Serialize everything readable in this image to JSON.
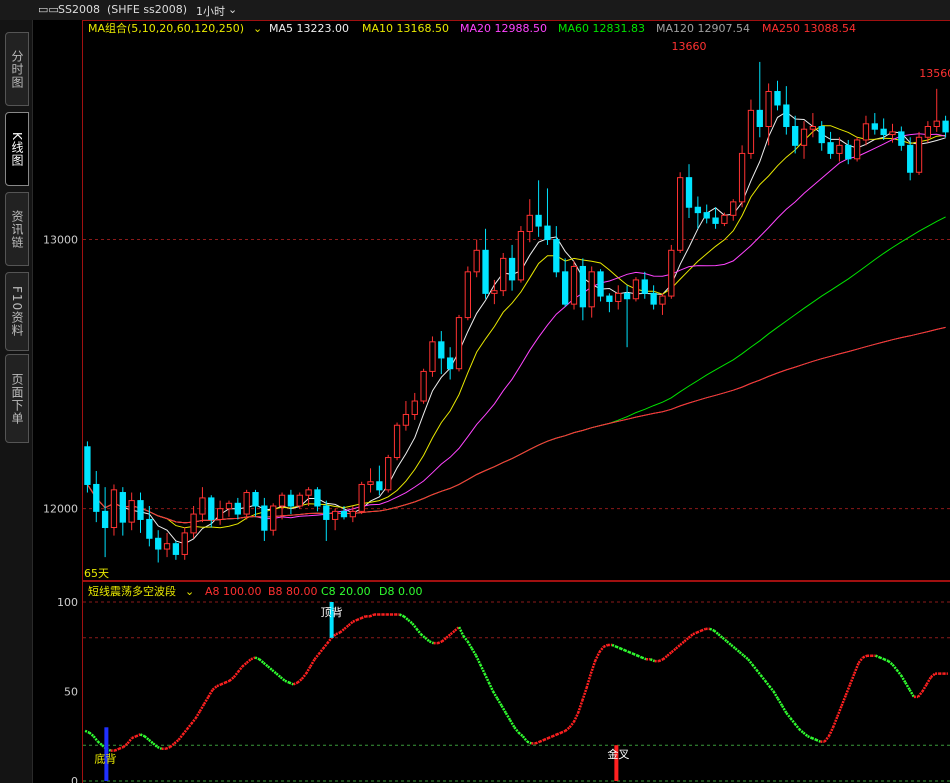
{
  "header": {
    "symbol_icon": "stock-symbol-icon",
    "symbol": "SS2008",
    "exchange_code": "(SHFE ss2008)",
    "period": "1小时",
    "period_icon": "chevron-down-icon"
  },
  "side_tabs": [
    {
      "label": "分时图",
      "active": false
    },
    {
      "label": "K线图",
      "active": true
    },
    {
      "label": "资讯链",
      "active": false
    },
    {
      "label": "F10资料",
      "active": false
    },
    {
      "label": "页面下单",
      "active": false
    }
  ],
  "colors": {
    "up": "#ff3232",
    "down": "#00e4ff",
    "ma5": "#eeeeee",
    "ma10": "#e8e800",
    "ma20": "#ff44ff",
    "ma60": "#00e400",
    "ma120": "#a0a0a0",
    "ma250": "#ff3030",
    "osc_up": "#ff2020",
    "osc_down": "#30ff30",
    "grid": "#8b1a1a"
  },
  "main_legend": {
    "group_label": "MA组合(5,10,20,60,120,250)",
    "items": [
      {
        "label": "MA5 13223.00",
        "color": "#eeeeee"
      },
      {
        "label": "MA10 13168.50",
        "color": "#e8e800"
      },
      {
        "label": "MA20 12988.50",
        "color": "#ff44ff"
      },
      {
        "label": "MA60 12831.83",
        "color": "#00e400"
      },
      {
        "label": "MA120 12907.54",
        "color": "#a0a0a0"
      },
      {
        "label": "MA250 13088.54",
        "color": "#ff3030"
      }
    ]
  },
  "osc_legend": {
    "title": "短线震荡多空波段",
    "items": [
      {
        "label": "A8 100.00",
        "color": "#ff3030"
      },
      {
        "label": "B8 80.00",
        "color": "#ff3030"
      },
      {
        "label": "C8 20.00",
        "color": "#30ff30"
      },
      {
        "label": "D8 0.00",
        "color": "#30ff30"
      }
    ]
  },
  "chart_data": [
    {
      "type": "candlestick",
      "title": "SS2008 1小时",
      "y_ticks": [
        12000,
        13000
      ],
      "ylim": [
        11735,
        13760
      ],
      "annotations": [
        {
          "text": "13660",
          "x_index": 68,
          "price": 13660
        },
        {
          "text": "13560",
          "x_index": 96,
          "price": 13560
        },
        {
          "text": "65天",
          "x_index": 0,
          "price": 11760
        }
      ],
      "candles": [
        [
          12230,
          12250,
          12060,
          12090
        ],
        [
          12090,
          12140,
          11950,
          11990
        ],
        [
          11990,
          12080,
          11820,
          11930
        ],
        [
          11930,
          12090,
          11900,
          12070
        ],
        [
          12060,
          12080,
          11900,
          11950
        ],
        [
          11950,
          12060,
          11920,
          12030
        ],
        [
          12030,
          12060,
          11910,
          11960
        ],
        [
          11960,
          12010,
          11860,
          11890
        ],
        [
          11890,
          11920,
          11800,
          11850
        ],
        [
          11850,
          11910,
          11820,
          11870
        ],
        [
          11870,
          11880,
          11810,
          11830
        ],
        [
          11830,
          11930,
          11810,
          11910
        ],
        [
          11910,
          12010,
          11890,
          11980
        ],
        [
          11980,
          12080,
          11950,
          12040
        ],
        [
          12040,
          12050,
          11930,
          11960
        ],
        [
          11960,
          12030,
          11940,
          12000
        ],
        [
          12000,
          12030,
          11970,
          12020
        ],
        [
          12020,
          12040,
          11960,
          11980
        ],
        [
          11980,
          12070,
          11960,
          12060
        ],
        [
          12060,
          12070,
          11970,
          12010
        ],
        [
          12010,
          12040,
          11880,
          11920
        ],
        [
          11920,
          12020,
          11900,
          12010
        ],
        [
          12010,
          12060,
          11960,
          12050
        ],
        [
          12050,
          12070,
          11980,
          12010
        ],
        [
          12010,
          12060,
          12000,
          12050
        ],
        [
          12050,
          12080,
          12010,
          12070
        ],
        [
          12070,
          12080,
          11990,
          12010
        ],
        [
          12010,
          12030,
          11880,
          11960
        ],
        [
          11960,
          12000,
          11920,
          11990
        ],
        [
          11990,
          12010,
          11960,
          11970
        ],
        [
          11970,
          12010,
          11950,
          11990
        ],
        [
          11990,
          12100,
          11980,
          12090
        ],
        [
          12090,
          12150,
          12060,
          12100
        ],
        [
          12100,
          12160,
          12050,
          12070
        ],
        [
          12070,
          12200,
          12060,
          12190
        ],
        [
          12190,
          12320,
          12180,
          12310
        ],
        [
          12310,
          12400,
          12290,
          12350
        ],
        [
          12350,
          12430,
          12330,
          12400
        ],
        [
          12400,
          12520,
          12390,
          12510
        ],
        [
          12510,
          12640,
          12490,
          12620
        ],
        [
          12620,
          12660,
          12500,
          12560
        ],
        [
          12560,
          12600,
          12480,
          12520
        ],
        [
          12520,
          12720,
          12510,
          12710
        ],
        [
          12710,
          12900,
          12700,
          12880
        ],
        [
          12880,
          13000,
          12860,
          12960
        ],
        [
          12960,
          13040,
          12780,
          12800
        ],
        [
          12800,
          12850,
          12760,
          12810
        ],
        [
          12810,
          12950,
          12790,
          12930
        ],
        [
          12930,
          12980,
          12810,
          12850
        ],
        [
          12850,
          13050,
          12840,
          13030
        ],
        [
          13030,
          13150,
          12990,
          13090
        ],
        [
          13090,
          13220,
          13010,
          13050
        ],
        [
          13050,
          13190,
          12980,
          13000
        ],
        [
          13000,
          13050,
          12860,
          12880
        ],
        [
          12880,
          12930,
          12750,
          12760
        ],
        [
          12760,
          12920,
          12740,
          12900
        ],
        [
          12900,
          12930,
          12700,
          12750
        ],
        [
          12750,
          12900,
          12710,
          12880
        ],
        [
          12880,
          12890,
          12770,
          12790
        ],
        [
          12790,
          12800,
          12730,
          12770
        ],
        [
          12770,
          12830,
          12740,
          12800
        ],
        [
          12800,
          12830,
          12600,
          12780
        ],
        [
          12780,
          12860,
          12770,
          12850
        ],
        [
          12850,
          12880,
          12780,
          12800
        ],
        [
          12800,
          12830,
          12740,
          12760
        ],
        [
          12760,
          12800,
          12720,
          12790
        ],
        [
          12790,
          12980,
          12780,
          12960
        ],
        [
          12960,
          13250,
          12950,
          13230
        ],
        [
          13230,
          13280,
          13080,
          13120
        ],
        [
          13120,
          13160,
          13040,
          13100
        ],
        [
          13100,
          13130,
          13060,
          13080
        ],
        [
          13080,
          13120,
          13040,
          13060
        ],
        [
          13060,
          13100,
          13050,
          13090
        ],
        [
          13090,
          13150,
          13070,
          13140
        ],
        [
          13140,
          13350,
          13120,
          13320
        ],
        [
          13320,
          13520,
          13300,
          13480
        ],
        [
          13480,
          13660,
          13380,
          13420
        ],
        [
          13420,
          13580,
          13350,
          13550
        ],
        [
          13550,
          13590,
          13480,
          13500
        ],
        [
          13500,
          13570,
          13390,
          13420
        ],
        [
          13420,
          13460,
          13320,
          13350
        ],
        [
          13350,
          13440,
          13300,
          13410
        ],
        [
          13410,
          13470,
          13380,
          13420
        ],
        [
          13420,
          13440,
          13330,
          13360
        ],
        [
          13360,
          13400,
          13300,
          13320
        ],
        [
          13320,
          13380,
          13290,
          13350
        ],
        [
          13350,
          13370,
          13280,
          13300
        ],
        [
          13300,
          13380,
          13290,
          13370
        ],
        [
          13370,
          13460,
          13350,
          13430
        ],
        [
          13430,
          13470,
          13390,
          13410
        ],
        [
          13410,
          13450,
          13370,
          13390
        ],
        [
          13390,
          13430,
          13360,
          13400
        ],
        [
          13400,
          13420,
          13330,
          13350
        ],
        [
          13350,
          13380,
          13220,
          13250
        ],
        [
          13250,
          13400,
          13240,
          13380
        ],
        [
          13380,
          13440,
          13360,
          13420
        ],
        [
          13420,
          13560,
          13400,
          13440
        ],
        [
          13440,
          13460,
          13380,
          13400
        ]
      ]
    },
    {
      "type": "line",
      "title": "短线震荡多空波段",
      "y_ticks": [
        0,
        50,
        100
      ],
      "ylim": [
        0,
        100
      ],
      "reference_lines": [
        100,
        80,
        20,
        0
      ],
      "annotations": [
        {
          "text": "底背",
          "x_index": 5,
          "kind": "bottom_divergence"
        },
        {
          "text": "顶背",
          "x_index": 58,
          "kind": "top_divergence"
        },
        {
          "text": "金叉",
          "x_index": 125,
          "kind": "golden_cross"
        }
      ],
      "values": [
        28,
        27,
        25,
        22,
        20,
        18,
        17,
        17,
        18,
        19,
        21,
        24,
        25,
        26,
        25,
        23,
        21,
        19,
        18,
        18,
        19,
        21,
        23,
        26,
        29,
        32,
        35,
        39,
        43,
        47,
        51,
        53,
        54,
        55,
        56,
        58,
        61,
        64,
        66,
        68,
        69,
        68,
        66,
        64,
        62,
        60,
        58,
        56,
        55,
        54,
        55,
        57,
        60,
        64,
        68,
        71,
        74,
        77,
        80,
        82,
        83,
        85,
        87,
        89,
        90,
        91,
        92,
        92,
        93,
        93,
        93,
        93,
        93,
        93,
        93,
        92,
        90,
        88,
        85,
        82,
        80,
        78,
        77,
        77,
        78,
        80,
        82,
        84,
        86,
        81,
        78,
        74,
        70,
        65,
        60,
        55,
        50,
        46,
        42,
        38,
        34,
        30,
        27,
        25,
        22,
        21,
        21,
        22,
        23,
        24,
        25,
        26,
        27,
        28,
        30,
        33,
        38,
        45,
        52,
        60,
        67,
        72,
        75,
        76,
        76,
        75,
        74,
        73,
        72,
        71,
        70,
        69,
        68,
        68,
        67,
        67,
        68,
        70,
        72,
        74,
        76,
        78,
        80,
        82,
        83,
        84,
        85,
        85,
        84,
        82,
        80,
        78,
        76,
        74,
        72,
        70,
        68,
        65,
        62,
        59,
        56,
        53,
        50,
        46,
        42,
        38,
        35,
        32,
        29,
        27,
        25,
        24,
        23,
        22,
        22,
        25,
        30,
        36,
        42,
        48,
        54,
        60,
        66,
        69,
        70,
        70,
        70,
        69,
        68,
        67,
        65,
        62,
        59,
        55,
        51,
        47,
        47,
        50,
        54,
        58,
        60,
        60,
        60,
        60
      ]
    }
  ]
}
